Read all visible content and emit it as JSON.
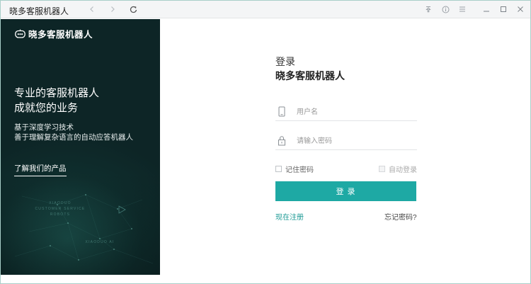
{
  "window": {
    "title": "晓多客服机器人"
  },
  "titlebar": {
    "icons": [
      "back-icon",
      "forward-icon",
      "refresh-icon",
      "pin-icon",
      "info-icon",
      "menu-icon",
      "minimize-icon",
      "maximize-icon",
      "close-icon"
    ]
  },
  "left_panel": {
    "brand": "晓多客服机器人",
    "headline_line1": "专业的客服机器人",
    "headline_line2": "成就您的业务",
    "sub_line1": "基于深度学习技术",
    "sub_line2": "善于理解复杂语言的自动应答机器人",
    "learn_more": "了解我们的产品",
    "watermark_line1": "XIAODUO",
    "watermark_line2": "CUSTOMER SERVICE",
    "watermark_line3": "ROBOTS",
    "watermark_line4": "XIAODUO AI"
  },
  "login_form": {
    "title": "登录",
    "subtitle": "晓多客服机器人",
    "username_placeholder": "用户名",
    "username_value": "",
    "password_placeholder": "请输入密码",
    "password_value": "",
    "remember_label": "记住密码",
    "auto_login_label": "自动登录",
    "login_button": "登 录",
    "register_link": "现在注册",
    "forgot_link": "忘记密码?"
  },
  "colors": {
    "accent": "#1ea9a4",
    "left_panel_bg": "#0d2526",
    "link": "#1e9b96"
  }
}
